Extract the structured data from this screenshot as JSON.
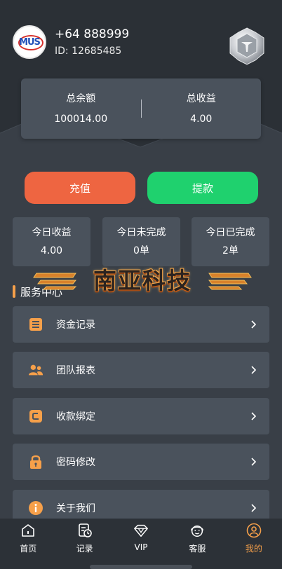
{
  "user": {
    "avatar_text": "MUS",
    "phone": "+64 888999",
    "id_text": "ID: 12685485"
  },
  "balance": {
    "total_balance_label": "总余额",
    "total_balance_value": "100014.00",
    "total_income_label": "总收益",
    "total_income_value": "4.00"
  },
  "actions": {
    "recharge_label": "充值",
    "withdraw_label": "提款"
  },
  "stats": [
    {
      "label": "今日收益",
      "value": "4.00"
    },
    {
      "label": "今日未完成",
      "value": "0单"
    },
    {
      "label": "今日已完成",
      "value": "2单"
    }
  ],
  "brand_text": "南亚科技",
  "section_title": "服务中心",
  "menu": [
    {
      "label": "资金记录",
      "icon": "list-icon"
    },
    {
      "label": "团队报表",
      "icon": "team-icon"
    },
    {
      "label": "收款绑定",
      "icon": "card-icon"
    },
    {
      "label": "密码修改",
      "icon": "lock-icon"
    },
    {
      "label": "关于我们",
      "icon": "info-icon"
    }
  ],
  "tabbar": [
    {
      "label": "首页",
      "icon": "home-icon",
      "active": false
    },
    {
      "label": "记录",
      "icon": "record-icon",
      "active": false
    },
    {
      "label": "VIP",
      "icon": "diamond-icon",
      "active": false
    },
    {
      "label": "客服",
      "icon": "customer-service-icon",
      "active": false
    },
    {
      "label": "我的",
      "icon": "profile-icon",
      "active": true
    }
  ],
  "colors": {
    "accent": "#f6a04a",
    "recharge": "#ee6541",
    "withdraw": "#1fd16e",
    "card": "#4a525c",
    "background": "#393f47"
  }
}
